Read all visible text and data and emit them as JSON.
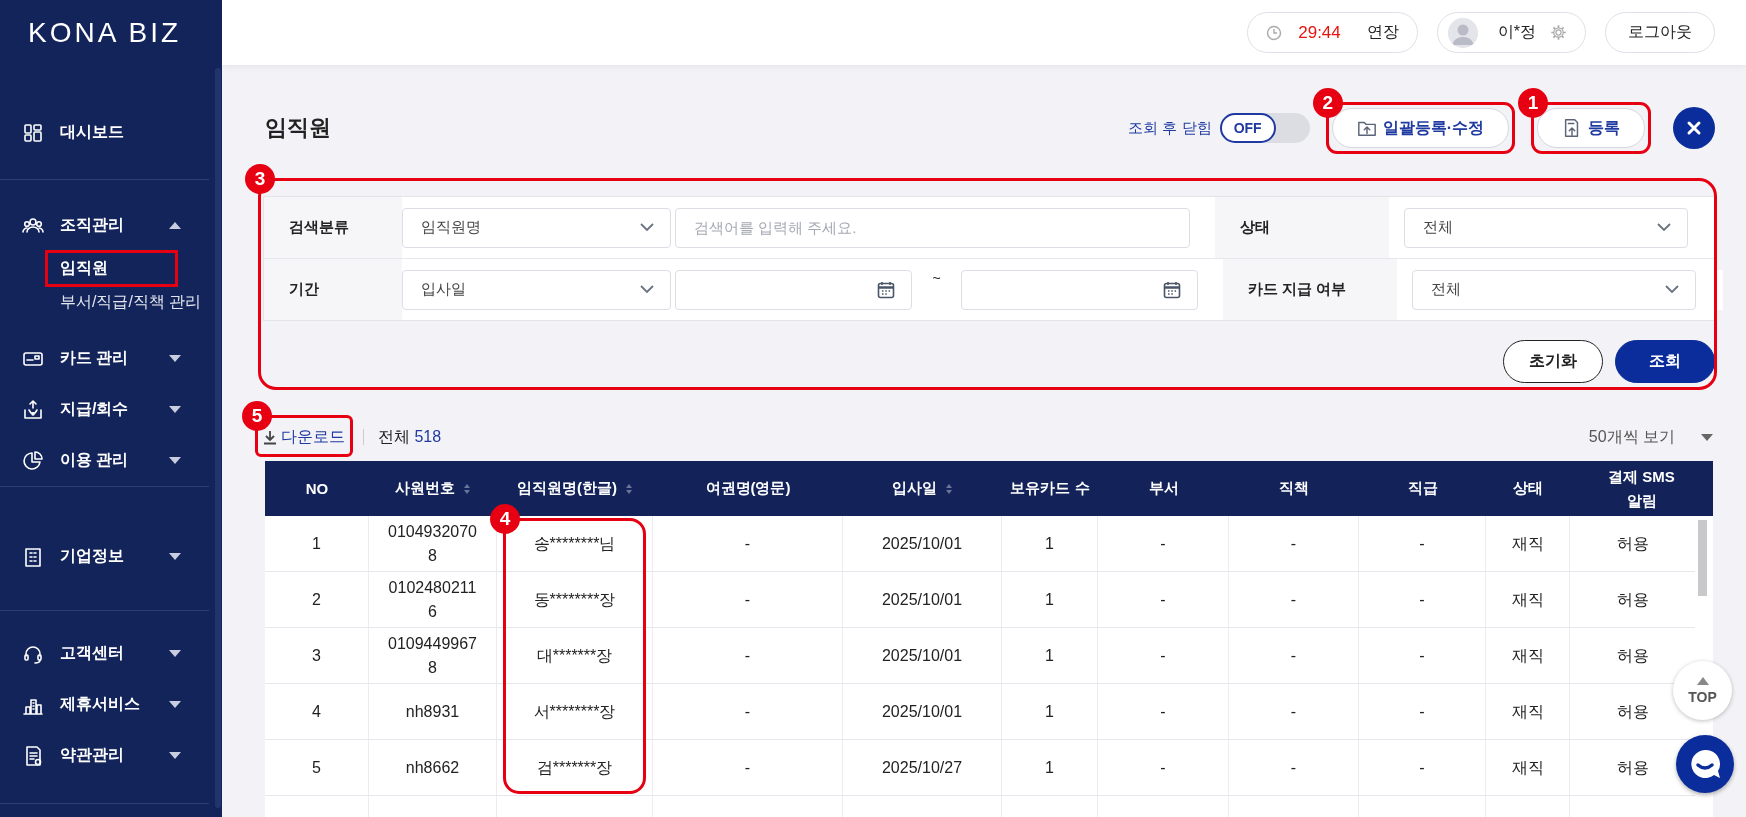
{
  "sidebar": {
    "logo": "KONA BIZ",
    "groups": [
      {
        "items": [
          {
            "label": "대시보드"
          }
        ]
      },
      {
        "items": [
          {
            "label": "조직관리",
            "expanded": true,
            "children": [
              {
                "label": "임직원",
                "selected": true,
                "annotated": true
              },
              {
                "label": "부서/직급/직책 관리",
                "selected": false,
                "annotated": false
              }
            ]
          },
          {
            "label": "카드 관리",
            "expanded": false
          },
          {
            "label": "지급/회수",
            "expanded": false
          },
          {
            "label": "이용 관리",
            "expanded": false
          }
        ]
      },
      {
        "items": [
          {
            "label": "기업정보",
            "expanded": false
          }
        ]
      },
      {
        "items": [
          {
            "label": "고객센터",
            "expanded": false
          },
          {
            "label": "제휴서비스",
            "expanded": false
          },
          {
            "label": "약관관리",
            "expanded": false
          }
        ]
      }
    ]
  },
  "header": {
    "timer": {
      "time": "29:44",
      "button": "연장"
    },
    "user": {
      "name": "이*정"
    },
    "logout": "로그아웃"
  },
  "page": {
    "title": "임직원",
    "close_after_search": {
      "label": "조회 후 닫힘",
      "toggle": "OFF",
      "on": false
    },
    "buttons": [
      "일괄등록·수정",
      "등록"
    ]
  },
  "search": {
    "rows": [
      {
        "label": "검색분류",
        "select": "임직원명",
        "placeholder": "검색어를 입력해 주세요.",
        "side_label": "상태",
        "side_select": "전체"
      },
      {
        "label": "기간",
        "select": "입사일",
        "separator": "~",
        "side_label": "카드 지급 여부",
        "side_select": "전체"
      }
    ],
    "buttons": [
      "초기화",
      "조회"
    ]
  },
  "list": {
    "download": "다운로드",
    "total_label": "전체",
    "total": "518",
    "page_size": "50개씩 보기"
  },
  "table": {
    "columns": [
      {
        "label": "NO",
        "sortable": false
      },
      {
        "label": "사원번호",
        "sortable": true
      },
      {
        "label": "임직원명(한글)",
        "sortable": true
      },
      {
        "label": "여권명(영문)",
        "sortable": false
      },
      {
        "label": "입사일",
        "sortable": true
      },
      {
        "label": "보유카드 수",
        "sortable": false
      },
      {
        "label": "부서",
        "sortable": false
      },
      {
        "label": "직책",
        "sortable": false
      },
      {
        "label": "직급",
        "sortable": false
      },
      {
        "label": "상태",
        "sortable": false
      },
      {
        "label": "결제 SMS 알림",
        "sortable": false
      }
    ],
    "rows": [
      [
        "1",
        "01049320708",
        "송********님",
        "-",
        "2025/10/01",
        "1",
        "-",
        "-",
        "-",
        "재직",
        "허용"
      ],
      [
        "2",
        "01024802116",
        "동********장",
        "-",
        "2025/10/01",
        "1",
        "-",
        "-",
        "-",
        "재직",
        "허용"
      ],
      [
        "3",
        "01094499678",
        "대*******장",
        "-",
        "2025/10/01",
        "1",
        "-",
        "-",
        "-",
        "재직",
        "허용"
      ],
      [
        "4",
        "nh8931",
        "서********장",
        "-",
        "2025/10/01",
        "1",
        "-",
        "-",
        "-",
        "재직",
        "허용"
      ],
      [
        "5",
        "nh8662",
        "검*******장",
        "-",
        "2025/10/27",
        "1",
        "-",
        "-",
        "-",
        "재직",
        "허용"
      ]
    ]
  },
  "floating": {
    "top": "TOP"
  },
  "annotations": [
    {
      "number": "1"
    },
    {
      "number": "2"
    },
    {
      "number": "3"
    },
    {
      "number": "4"
    },
    {
      "number": "5"
    }
  ]
}
